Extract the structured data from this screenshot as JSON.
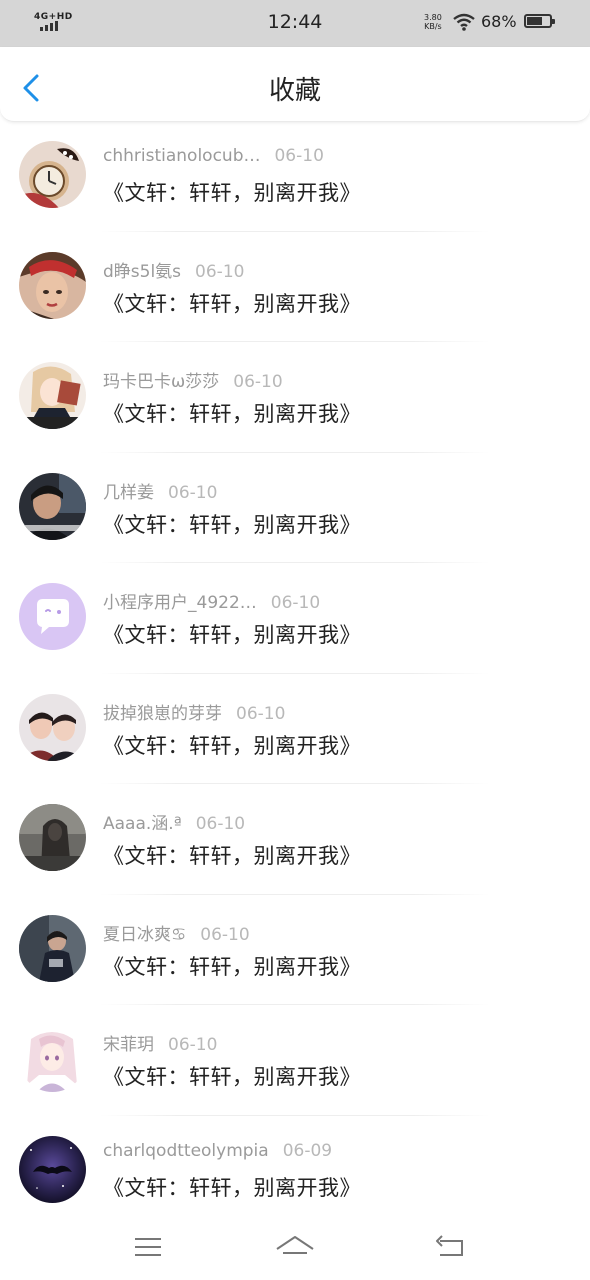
{
  "status_bar": {
    "network": "4G+HD",
    "time": "12:44",
    "speed_value": "3.80",
    "speed_unit": "KB/s",
    "battery_percent": "68%",
    "battery_level": 0.68
  },
  "header": {
    "title": "收藏"
  },
  "favorites": [
    {
      "user": "chhristianolocub…",
      "date": "06-10",
      "title": "《文轩：轩轩，别离开我》",
      "avatar": "avatar-clock-icon"
    },
    {
      "user": "d睁s5l氨s",
      "date": "06-10",
      "title": "《文轩：轩轩，别离开我》",
      "avatar": "avatar-portrait-icon"
    },
    {
      "user": "玛卡巴卡ω莎莎",
      "date": "06-10",
      "title": "《文轩：轩轩，别离开我》",
      "avatar": "avatar-anime-girl-icon"
    },
    {
      "user": "几样姜",
      "date": "06-10",
      "title": "《文轩：轩轩，别离开我》",
      "avatar": "avatar-photo-icon"
    },
    {
      "user": "小程序用户_4922…",
      "date": "06-10",
      "title": "《文轩：轩轩，别离开我》",
      "avatar": "avatar-default-chat-icon"
    },
    {
      "user": "拔掉狼崽的芽芽",
      "date": "06-10",
      "title": "《文轩：轩轩，别离开我》",
      "avatar": "avatar-duo-photo-icon"
    },
    {
      "user": "Aaaa.涵.ª",
      "date": "06-10",
      "title": "《文轩：轩轩，别离开我》",
      "avatar": "avatar-hooded-figure-icon"
    },
    {
      "user": "夏日冰爽♋",
      "date": "06-10",
      "title": "《文轩：轩轩，别离开我》",
      "avatar": "avatar-street-photo-icon"
    },
    {
      "user": "宋菲玥",
      "date": "06-10",
      "title": "《文轩：轩轩，别离开我》",
      "avatar": "avatar-anime-pink-icon"
    },
    {
      "user": "charlqodtteolympia",
      "date": "06-09",
      "title": "《文轩：轩轩，别离开我》",
      "avatar": "avatar-mustache-icon"
    }
  ],
  "colors": {
    "accent": "#1e90e8",
    "status_bar_bg": "#d6d6d6",
    "meta_text": "#9a9a9a",
    "title_text": "#222222"
  },
  "bottom_nav": {
    "menu": "menu-icon",
    "home": "home-icon",
    "back": "back-arrow-icon"
  }
}
